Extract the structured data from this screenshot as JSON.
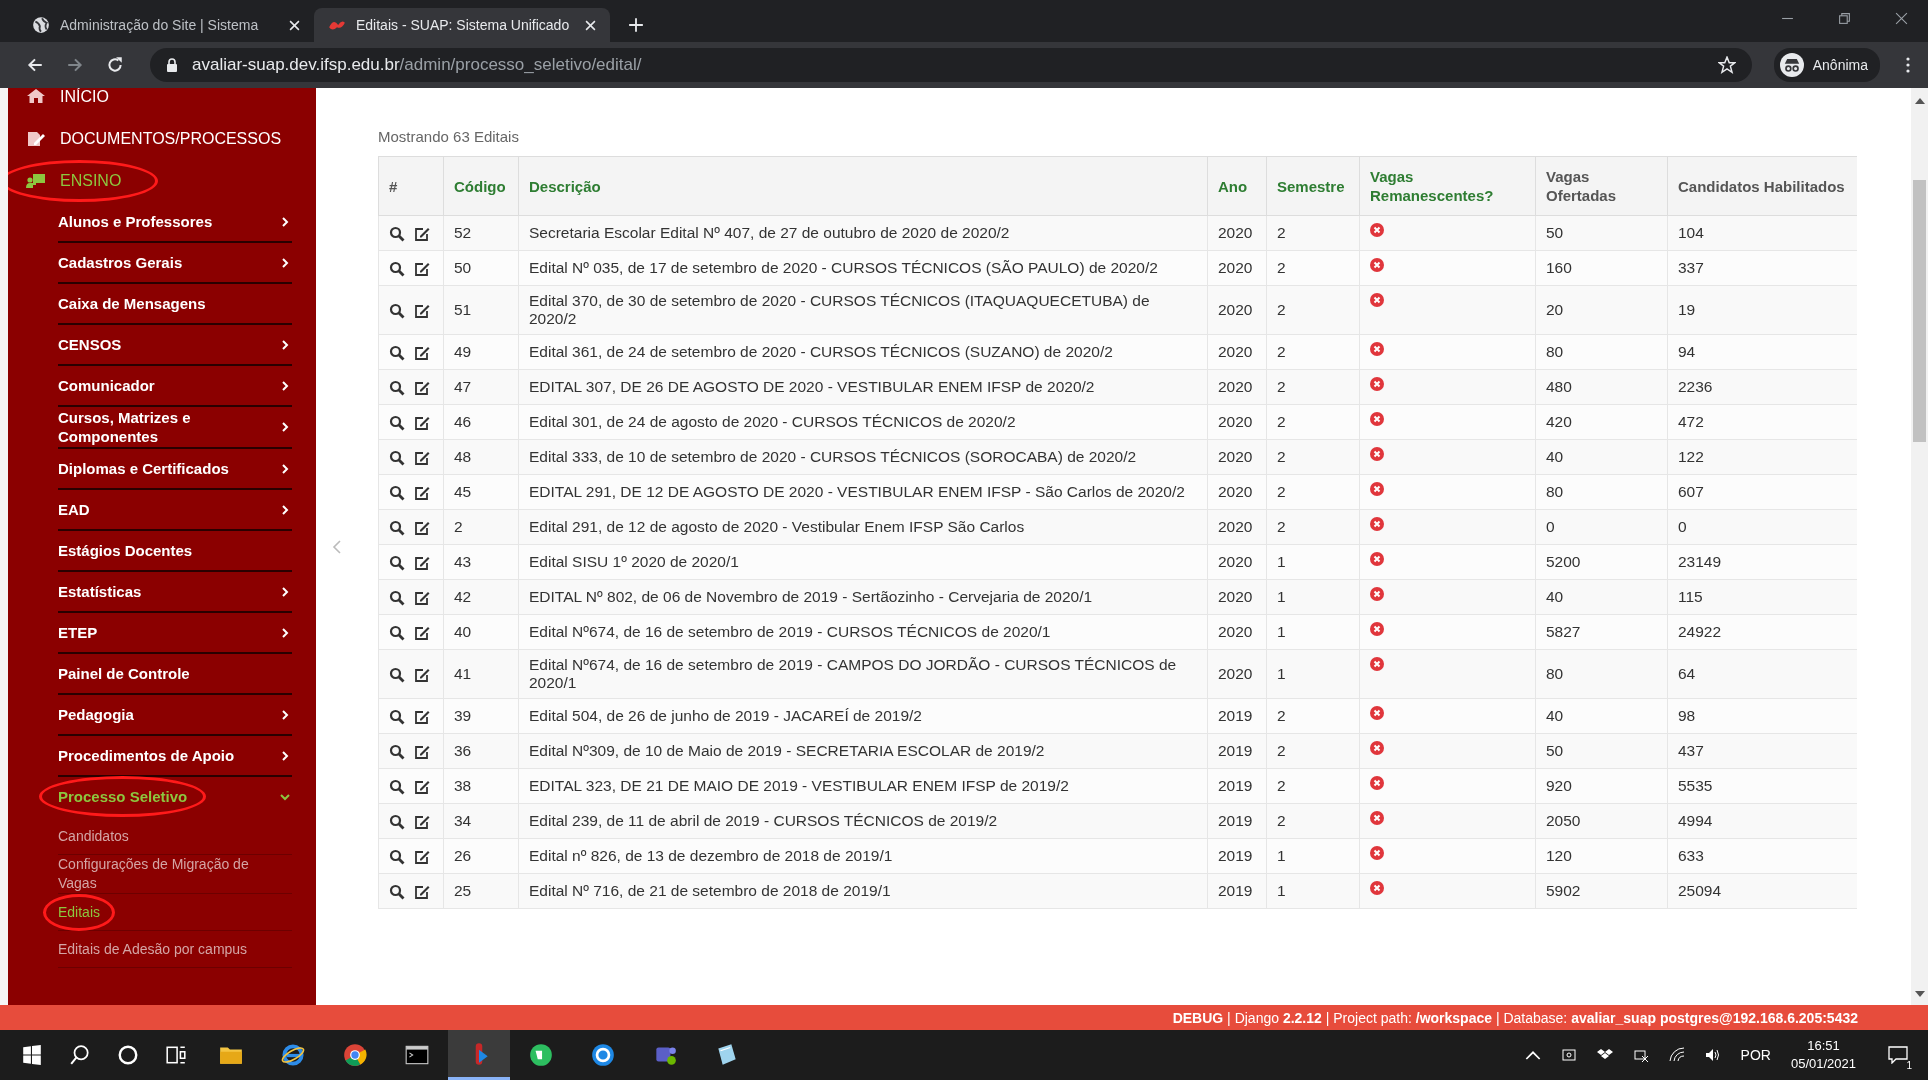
{
  "browser": {
    "tabs": [
      {
        "title": "Administração do Site | Sistema",
        "selected": false
      },
      {
        "title": "Editais - SUAP: Sistema Unificado",
        "selected": true
      }
    ],
    "url": {
      "domain": "avaliar-suap.dev.ifsp.edu.br",
      "path": "/admin/processo_seletivo/edital/"
    },
    "profile": "Anônima"
  },
  "sidebar": {
    "items": [
      {
        "label": "INÍCIO",
        "selected": false,
        "circled": false
      },
      {
        "label": "DOCUMENTOS/PROCESSOS",
        "selected": false,
        "circled": false
      },
      {
        "label": "ENSINO",
        "selected": true,
        "circled": true,
        "children": [
          {
            "label": "Alunos e Professores",
            "kind": "submenu",
            "expanded": false,
            "selected": false,
            "circled": false
          },
          {
            "label": "Cadastros Gerais",
            "kind": "submenu",
            "expanded": false,
            "selected": false,
            "circled": false
          },
          {
            "label": "Caixa de Mensagens",
            "kind": "link",
            "selected": false,
            "circled": false
          },
          {
            "label": "CENSOS",
            "kind": "submenu",
            "expanded": false,
            "selected": false,
            "circled": false
          },
          {
            "label": "Comunicador",
            "kind": "submenu",
            "expanded": false,
            "selected": false,
            "circled": false
          },
          {
            "label": "Cursos, Matrizes e Componentes",
            "kind": "submenu",
            "expanded": false,
            "selected": false,
            "circled": false
          },
          {
            "label": "Diplomas e Certificados",
            "kind": "submenu",
            "expanded": false,
            "selected": false,
            "circled": false
          },
          {
            "label": "EAD",
            "kind": "submenu",
            "expanded": false,
            "selected": false,
            "circled": false
          },
          {
            "label": "Estágios Docentes",
            "kind": "link",
            "selected": false,
            "circled": false
          },
          {
            "label": "Estatísticas",
            "kind": "submenu",
            "expanded": false,
            "selected": false,
            "circled": false
          },
          {
            "label": "ETEP",
            "kind": "submenu",
            "expanded": false,
            "selected": false,
            "circled": false
          },
          {
            "label": "Painel de Controle",
            "kind": "link",
            "selected": false,
            "circled": false
          },
          {
            "label": "Pedagogia",
            "kind": "submenu",
            "expanded": false,
            "selected": false,
            "circled": false
          },
          {
            "label": "Procedimentos de Apoio",
            "kind": "submenu",
            "expanded": false,
            "selected": false,
            "circled": false
          },
          {
            "label": "Processo Seletivo",
            "kind": "submenu",
            "expanded": true,
            "selected": true,
            "circled": true,
            "children": [
              {
                "label": "Candidatos",
                "selected": false,
                "circled": false
              },
              {
                "label": "Configurações de Migração de Vagas",
                "selected": false,
                "circled": false
              },
              {
                "label": "Editais",
                "selected": true,
                "circled": true
              },
              {
                "label": "Editais de Adesão por campus",
                "selected": false,
                "circled": false
              }
            ]
          }
        ]
      }
    ]
  },
  "content": {
    "count": "Mostrando 63 Editais",
    "table": {
      "columns": [
        {
          "label": "#",
          "sortable": false
        },
        {
          "label": "Código",
          "sortable": true
        },
        {
          "label": "Descrição",
          "sortable": true
        },
        {
          "label": "Ano",
          "sortable": true
        },
        {
          "label": "Semestre",
          "sortable": true
        },
        {
          "label": "Vagas Remanescentes?",
          "sortable": true
        },
        {
          "label": "Vagas Ofertadas",
          "sortable": false
        },
        {
          "label": "Candidatos Habilitados",
          "sortable": false
        }
      ],
      "rows": [
        {
          "codigo": "52",
          "descricao": "Secretaria Escolar Edital Nº 407, de 27 de outubro de 2020 de 2020/2",
          "ano": "2020",
          "semestre": "2",
          "remanescentes": false,
          "vagas": "50",
          "candidatos": "104"
        },
        {
          "codigo": "50",
          "descricao": "Edital Nº 035, de 17 de setembro de 2020 - CURSOS TÉCNICOS (SÃO PAULO) de 2020/2",
          "ano": "2020",
          "semestre": "2",
          "remanescentes": false,
          "vagas": "160",
          "candidatos": "337"
        },
        {
          "codigo": "51",
          "descricao": "Edital 370, de 30 de setembro de 2020 - CURSOS TÉCNICOS (ITAQUAQUECETUBA) de 2020/2",
          "ano": "2020",
          "semestre": "2",
          "remanescentes": false,
          "vagas": "20",
          "candidatos": "19"
        },
        {
          "codigo": "49",
          "descricao": "Edital 361, de 24 de setembro de 2020 - CURSOS TÉCNICOS (SUZANO) de 2020/2",
          "ano": "2020",
          "semestre": "2",
          "remanescentes": false,
          "vagas": "80",
          "candidatos": "94"
        },
        {
          "codigo": "47",
          "descricao": "EDITAL 307, DE 26 DE AGOSTO DE 2020 - VESTIBULAR ENEM IFSP de 2020/2",
          "ano": "2020",
          "semestre": "2",
          "remanescentes": false,
          "vagas": "480",
          "candidatos": "2236"
        },
        {
          "codigo": "46",
          "descricao": "Edital 301, de 24 de agosto de 2020 - CURSOS TÉCNICOS de 2020/2",
          "ano": "2020",
          "semestre": "2",
          "remanescentes": false,
          "vagas": "420",
          "candidatos": "472"
        },
        {
          "codigo": "48",
          "descricao": "Edital 333, de 10 de setembro de 2020 - CURSOS TÉCNICOS (SOROCABA) de 2020/2",
          "ano": "2020",
          "semestre": "2",
          "remanescentes": false,
          "vagas": "40",
          "candidatos": "122"
        },
        {
          "codigo": "45",
          "descricao": "EDITAL 291, DE 12 DE AGOSTO DE 2020 - VESTIBULAR ENEM IFSP - São Carlos de 2020/2",
          "ano": "2020",
          "semestre": "2",
          "remanescentes": false,
          "vagas": "80",
          "candidatos": "607"
        },
        {
          "codigo": "2",
          "descricao": "Edital 291, de 12 de agosto de 2020 - Vestibular Enem IFSP São Carlos",
          "ano": "2020",
          "semestre": "2",
          "remanescentes": false,
          "vagas": "0",
          "candidatos": "0"
        },
        {
          "codigo": "43",
          "descricao": "Edital SISU 1º 2020 de 2020/1",
          "ano": "2020",
          "semestre": "1",
          "remanescentes": false,
          "vagas": "5200",
          "candidatos": "23149"
        },
        {
          "codigo": "42",
          "descricao": "EDITAL Nº 802, de 06 de Novembro de 2019 - Sertãozinho - Cervejaria de 2020/1",
          "ano": "2020",
          "semestre": "1",
          "remanescentes": false,
          "vagas": "40",
          "candidatos": "115"
        },
        {
          "codigo": "40",
          "descricao": "Edital Nº674, de 16 de setembro de 2019 - CURSOS TÉCNICOS de 2020/1",
          "ano": "2020",
          "semestre": "1",
          "remanescentes": false,
          "vagas": "5827",
          "candidatos": "24922"
        },
        {
          "codigo": "41",
          "descricao": "Edital Nº674, de 16 de setembro de 2019 - CAMPOS DO JORDÃO - CURSOS TÉCNICOS de 2020/1",
          "ano": "2020",
          "semestre": "1",
          "remanescentes": false,
          "vagas": "80",
          "candidatos": "64"
        },
        {
          "codigo": "39",
          "descricao": "Edital 504, de 26 de junho de 2019 - JACAREÍ de 2019/2",
          "ano": "2019",
          "semestre": "2",
          "remanescentes": false,
          "vagas": "40",
          "candidatos": "98"
        },
        {
          "codigo": "36",
          "descricao": "Edital Nº309, de 10 de Maio de 2019 - SECRETARIA ESCOLAR de 2019/2",
          "ano": "2019",
          "semestre": "2",
          "remanescentes": false,
          "vagas": "50",
          "candidatos": "437"
        },
        {
          "codigo": "38",
          "descricao": "EDITAL 323, DE 21 DE MAIO DE 2019 - VESTIBULAR ENEM IFSP de 2019/2",
          "ano": "2019",
          "semestre": "2",
          "remanescentes": false,
          "vagas": "920",
          "candidatos": "5535"
        },
        {
          "codigo": "34",
          "descricao": "Edital 239, de 11 de abril de 2019 - CURSOS TÉCNICOS de 2019/2",
          "ano": "2019",
          "semestre": "2",
          "remanescentes": false,
          "vagas": "2050",
          "candidatos": "4994"
        },
        {
          "codigo": "26",
          "descricao": "Edital nº 826, de 13 de dezembro de 2018 de 2019/1",
          "ano": "2019",
          "semestre": "1",
          "remanescentes": false,
          "vagas": "120",
          "candidatos": "633"
        },
        {
          "codigo": "25",
          "descricao": "Edital Nº 716, de 21 de setembro de 2018 de 2019/1",
          "ano": "2019",
          "semestre": "1",
          "remanescentes": false,
          "vagas": "5902",
          "candidatos": "25094"
        }
      ]
    }
  },
  "debug_bar": "**DEBUG** | Django **2.2.12** | Project path: **/workspace** | Database: **avaliar_suap postgres@192.168.6.205:5432**",
  "taskbar": {
    "apps": [
      {
        "kind": "folder",
        "active": false
      },
      {
        "kind": "ie",
        "active": false
      },
      {
        "kind": "chrome",
        "active": false
      },
      {
        "kind": "terminal",
        "active": false
      },
      {
        "kind": "suap",
        "active": true
      },
      {
        "kind": "evernote",
        "active": false
      },
      {
        "kind": "sync",
        "active": false
      },
      {
        "kind": "teams",
        "active": false
      },
      {
        "kind": "notes",
        "active": false
      }
    ],
    "language": "POR",
    "time": "16:51",
    "date": "05/01/2021",
    "notifications": "1"
  }
}
